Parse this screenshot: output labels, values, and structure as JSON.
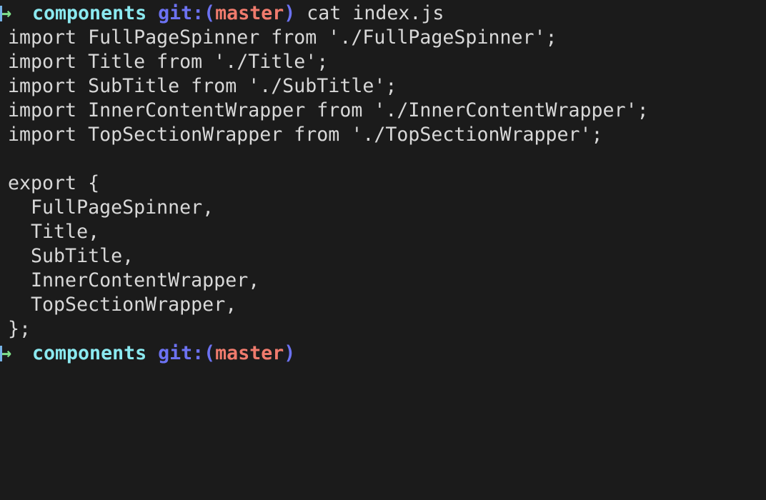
{
  "terminal": {
    "prompt": {
      "arrow": "→",
      "dir": "components",
      "git_label": "git:(",
      "branch": "master",
      "git_close": ")"
    },
    "command": "cat index.js",
    "output": [
      "import FullPageSpinner from './FullPageSpinner';",
      "import Title from './Title';",
      "import SubTitle from './SubTitle';",
      "import InnerContentWrapper from './InnerContentWrapper';",
      "import TopSectionWrapper from './TopSectionWrapper';",
      "",
      "export {",
      "  FullPageSpinner,",
      "  Title,",
      "  SubTitle,",
      "  InnerContentWrapper,",
      "  TopSectionWrapper,",
      "};"
    ],
    "colors": {
      "background": "#1b1b1b",
      "text": "#d8d8d8",
      "arrow": "#7ee08a",
      "dir": "#8be9f0",
      "git": "#6c72f2",
      "branch": "#f07b6d"
    }
  }
}
